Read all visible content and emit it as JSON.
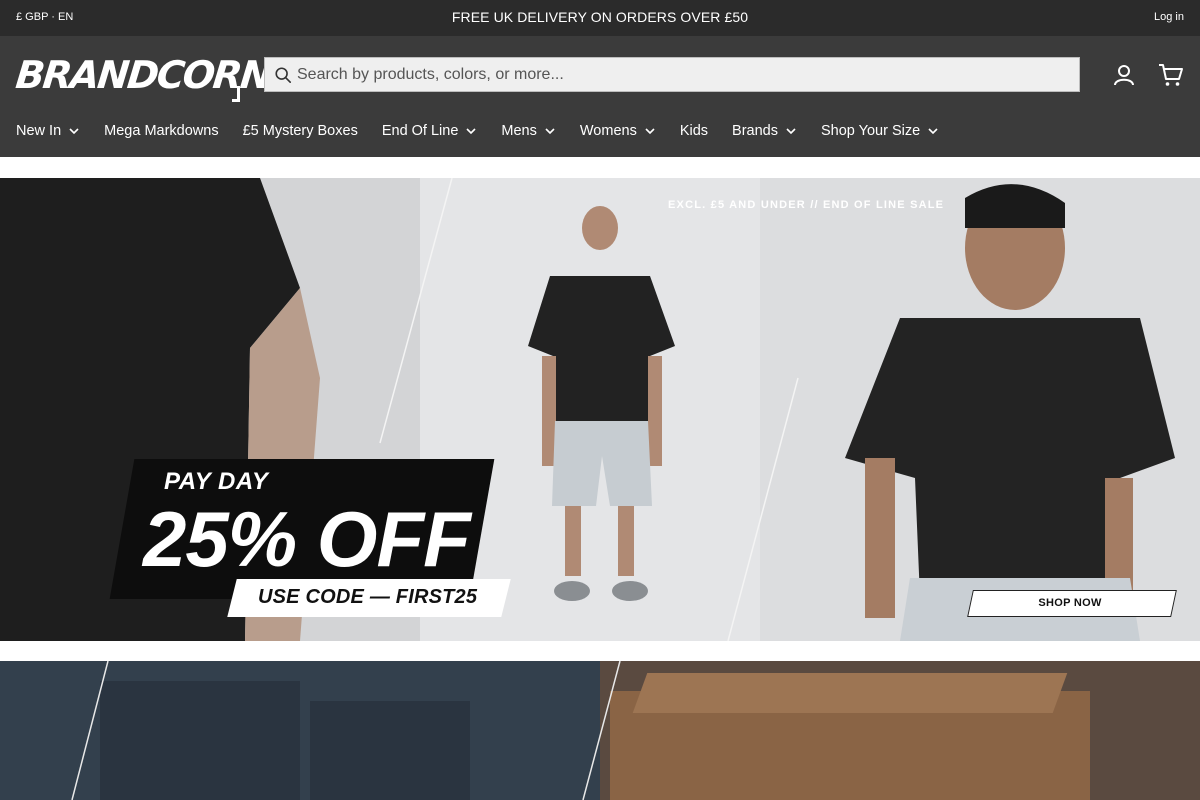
{
  "topbar": {
    "locale": "£ GBP · EN",
    "promo": "FREE UK DELIVERY ON ORDERS OVER £50",
    "login": "Log in"
  },
  "header": {
    "logo_text": "BRANDCORNER",
    "search_placeholder": "Search by products, colors, or more...",
    "icons": [
      "search-icon",
      "account-icon",
      "cart-icon"
    ]
  },
  "nav": {
    "items": [
      {
        "label": "New In",
        "dropdown": true
      },
      {
        "label": "Mega Markdowns",
        "dropdown": false
      },
      {
        "label": "£5 Mystery Boxes",
        "dropdown": false
      },
      {
        "label": "End Of Line",
        "dropdown": true
      },
      {
        "label": "Mens",
        "dropdown": true
      },
      {
        "label": "Womens",
        "dropdown": true
      },
      {
        "label": "Kids",
        "dropdown": false
      },
      {
        "label": "Brands",
        "dropdown": true
      },
      {
        "label": "Shop Your Size",
        "dropdown": true
      }
    ]
  },
  "hero": {
    "excl_text": "EXCL. £5 AND UNDER // END OF LINE SALE",
    "pay_day": "PAY DAY",
    "discount": "25% OFF",
    "code_text": "USE CODE — FIRST25",
    "cta": "SHOP NOW"
  },
  "colors": {
    "topbar_bg": "#2b2b2b",
    "header_bg": "#3b3b3b",
    "search_bg": "#efefef",
    "hero_bg": "#dedfe1",
    "text_light": "#ffffff"
  }
}
